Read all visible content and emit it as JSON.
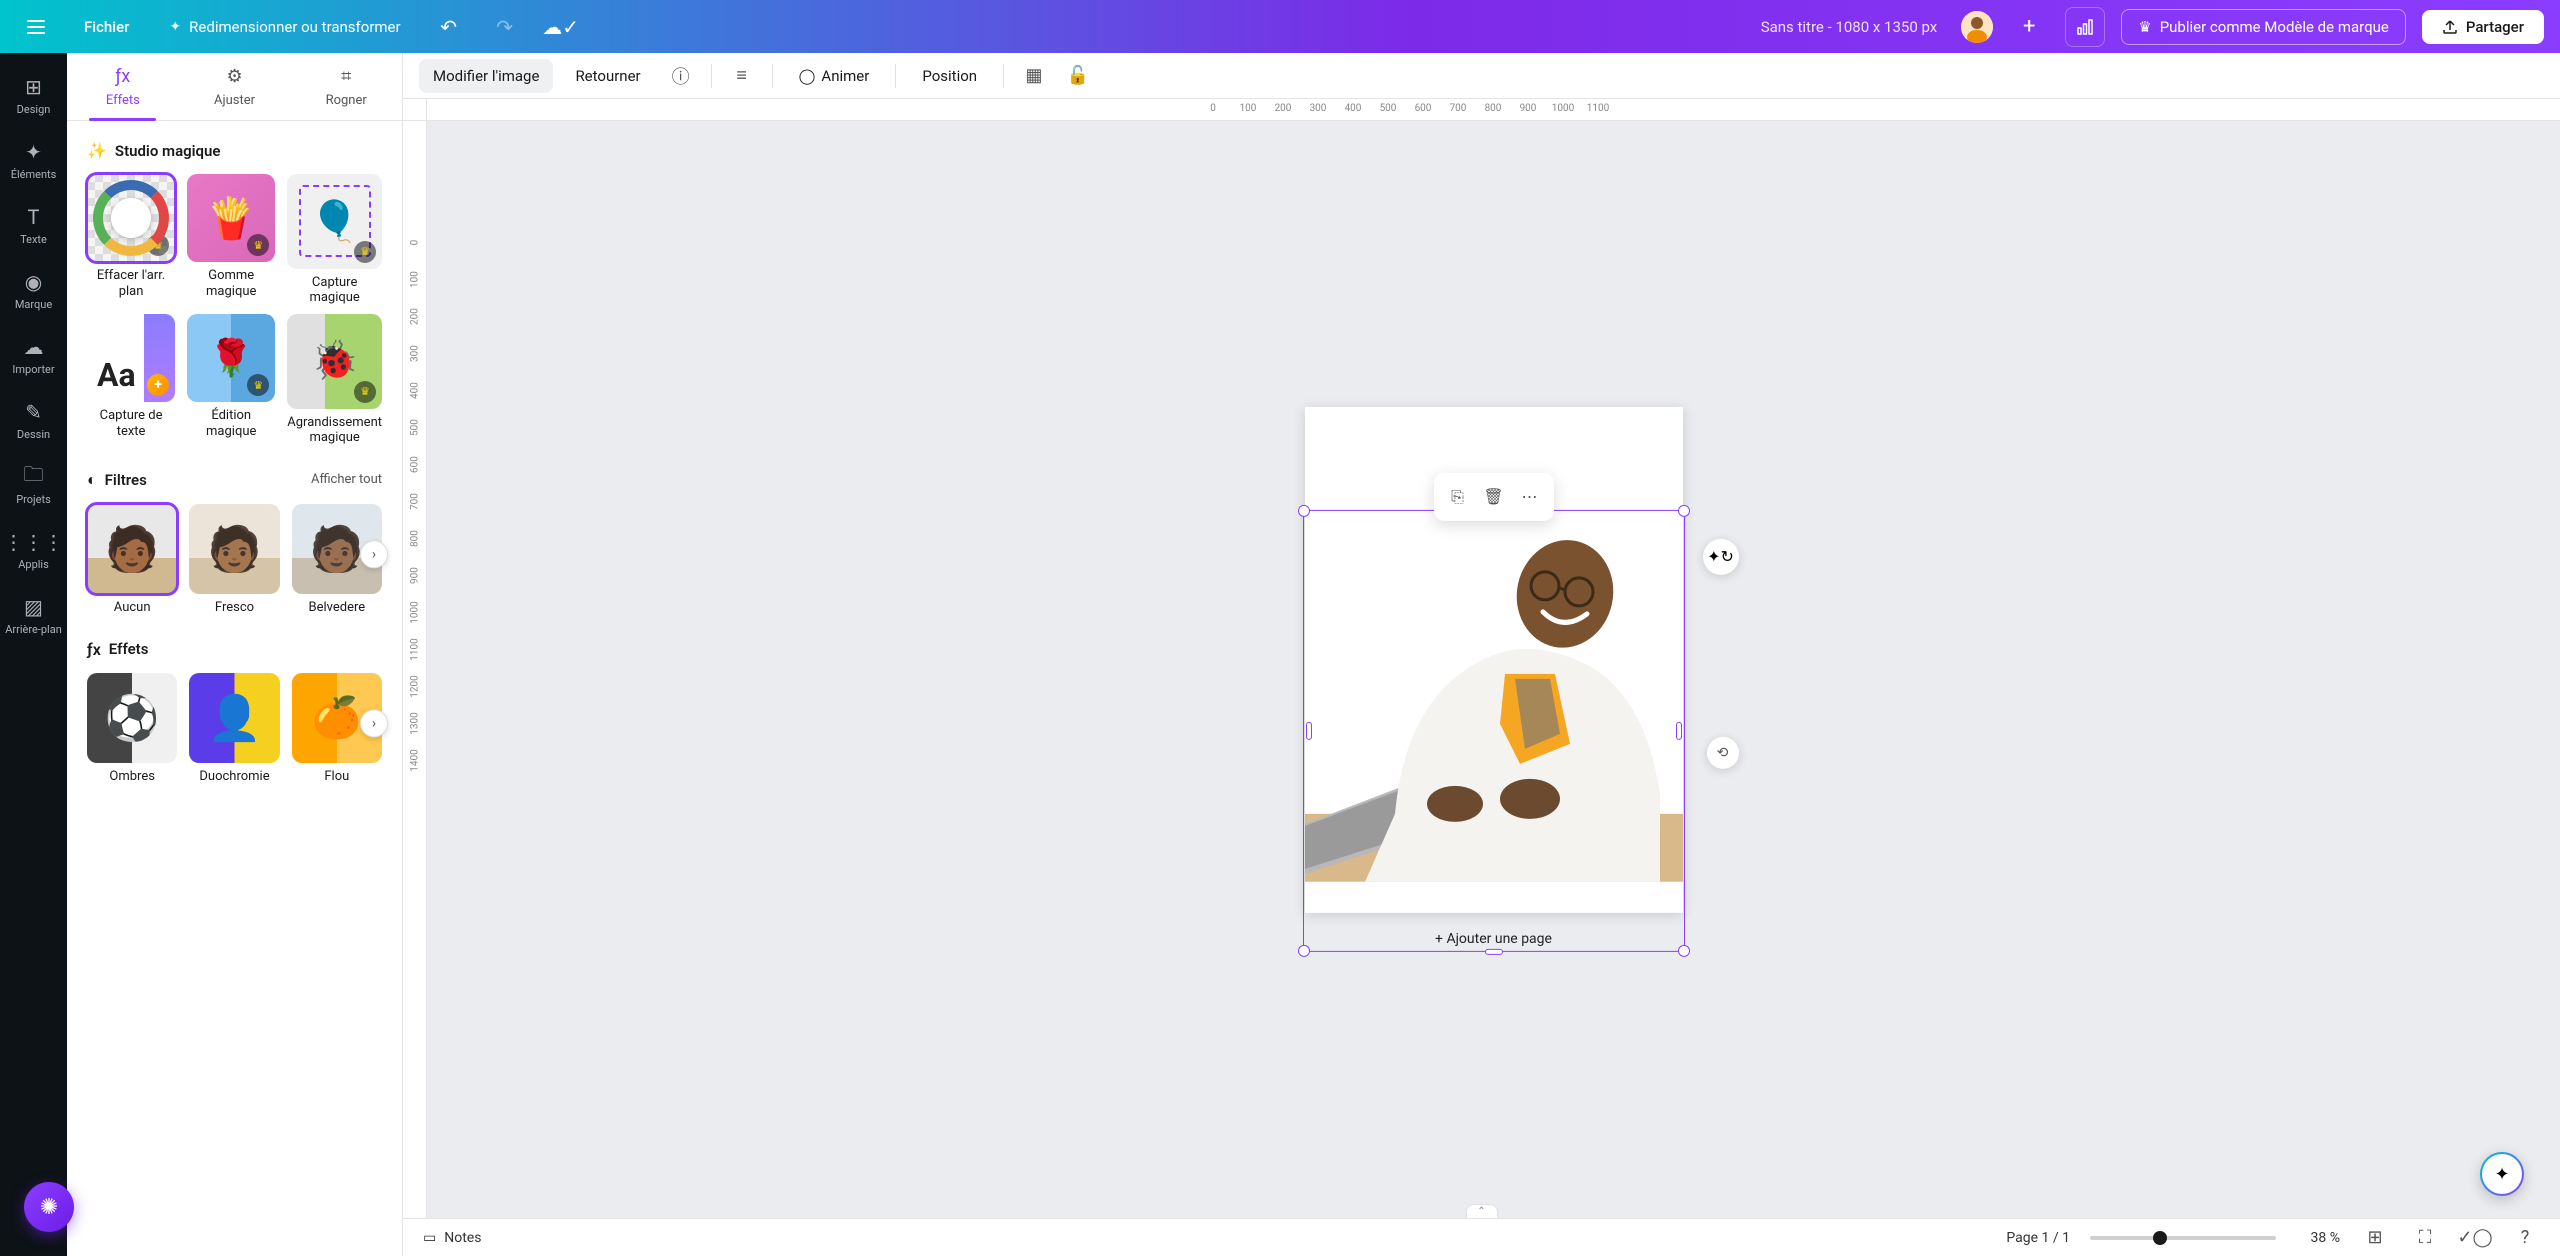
{
  "topbar": {
    "file": "Fichier",
    "resize": "Redimensionner ou transformer",
    "title_placeholder": "Sans titre - 1080 x 1350 px",
    "publish": "Publier comme Modèle de marque",
    "share": "Partager"
  },
  "rail": [
    {
      "icon": "⊞",
      "label": "Design"
    },
    {
      "icon": "✦",
      "label": "Éléments"
    },
    {
      "icon": "T",
      "label": "Texte"
    },
    {
      "icon": "◉",
      "label": "Marque"
    },
    {
      "icon": "☁",
      "label": "Importer"
    },
    {
      "icon": "✎",
      "label": "Dessin"
    },
    {
      "icon": "🗀",
      "label": "Projets"
    },
    {
      "icon": "⋮⋮⋮",
      "label": "Applis"
    },
    {
      "icon": "▨",
      "label": "Arrière-plan"
    }
  ],
  "tabs": {
    "effects": "Effets",
    "adjust": "Ajuster",
    "crop": "Rogner"
  },
  "sections": {
    "studio": {
      "title": "Studio magique",
      "items": [
        {
          "label": "Effacer l'arr. plan",
          "badge": "crown",
          "art": "t-checker t-bg-donut t-overlay-circle t-overlay-sliders",
          "selected": true
        },
        {
          "label": "Gomme magique",
          "badge": "crown",
          "art": "t-pink t-fries"
        },
        {
          "label": "Capture magique",
          "badge": "crown",
          "art": "t-balloon t-bbox"
        },
        {
          "label": "Capture de texte",
          "badge": "plus",
          "art": "t-aa"
        },
        {
          "label": "Édition magique",
          "badge": "crown",
          "art": "t-rose"
        },
        {
          "label": "Agrandissement magique",
          "badge": "crown",
          "art": "t-checker t-ladybug"
        }
      ]
    },
    "filters": {
      "title": "Filtres",
      "show_all": "Afficher tout",
      "items": [
        {
          "label": "Aucun",
          "art": "t-person-none",
          "selected": true
        },
        {
          "label": "Fresco",
          "art": "t-person-fresco"
        },
        {
          "label": "Belvedere",
          "art": "t-person-belv"
        }
      ]
    },
    "effects": {
      "title": "Effets",
      "items": [
        {
          "label": "Ombres",
          "art": "t-shadow"
        },
        {
          "label": "Duochromie",
          "art": "t-duo"
        },
        {
          "label": "Flou",
          "art": "t-blur"
        }
      ]
    }
  },
  "context": {
    "modify": "Modifier l'image",
    "flip": "Retourner",
    "animate": "Animer",
    "position": "Position"
  },
  "ruler_h": [
    0,
    100,
    200,
    300,
    400,
    500,
    600,
    700,
    800,
    900,
    1000,
    1100
  ],
  "ruler_v": [
    0,
    100,
    200,
    300,
    400,
    500,
    600,
    700,
    800,
    900,
    1000,
    1100,
    1200,
    1300,
    1400
  ],
  "add_page": "+ Ajouter une page",
  "bottom": {
    "notes": "Notes",
    "page": "Page 1 / 1",
    "zoom": "38 %"
  }
}
